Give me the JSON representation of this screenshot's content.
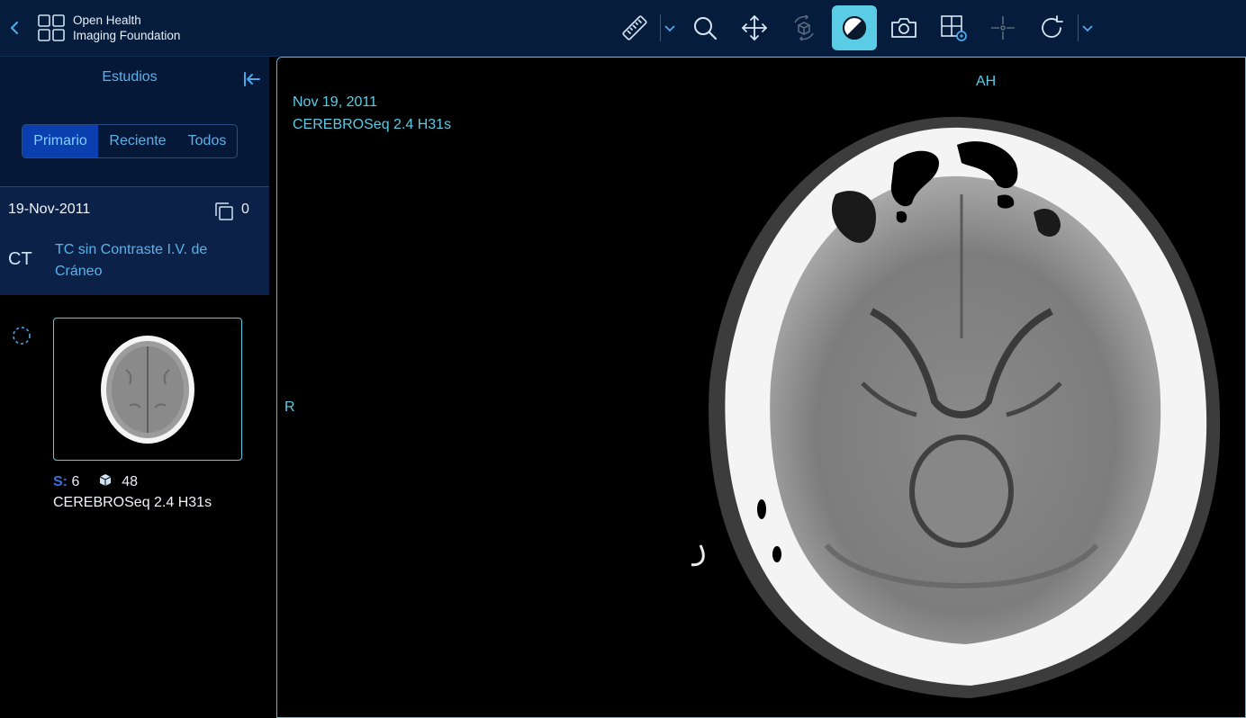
{
  "header": {
    "brand_line1": "Open Health",
    "brand_line2": "Imaging Foundation",
    "back_icon": "chevron-left-icon",
    "logo_icon": "grid-logo-icon"
  },
  "toolbar": {
    "tools": [
      {
        "name": "measure",
        "icon": "ruler-icon",
        "has_dropdown": true
      },
      {
        "name": "zoom",
        "icon": "magnifier-icon"
      },
      {
        "name": "pan",
        "icon": "move-arrows-icon"
      },
      {
        "name": "3d-rotate",
        "icon": "cube-rotate-icon",
        "disabled": true
      },
      {
        "name": "window-level",
        "icon": "contrast-icon",
        "active": true
      },
      {
        "name": "capture",
        "icon": "camera-icon"
      },
      {
        "name": "layout",
        "icon": "layout-gear-icon"
      },
      {
        "name": "crosshairs",
        "icon": "crosshair-icon",
        "disabled": true
      },
      {
        "name": "reset",
        "icon": "rotate-icon",
        "has_dropdown": true
      }
    ]
  },
  "panel": {
    "title": "Estudios",
    "collapse_icon": "collapse-left-icon",
    "tabs": [
      {
        "label": "Primario",
        "selected": true
      },
      {
        "label": "Reciente",
        "selected": false
      },
      {
        "label": "Todos",
        "selected": false
      }
    ],
    "study": {
      "date": "19-Nov-2011",
      "copy_icon": "copy-icon",
      "count": "0",
      "modality": "CT",
      "description": "TC sin Contraste I.V. de Cráneo"
    },
    "series": {
      "s_label": "S:",
      "s_value": "6",
      "instances_icon": "cube-icon",
      "instances": "48",
      "name": "CEREBROSeq 2.4 H31s",
      "loading_icon": "loading-circle-icon"
    }
  },
  "viewport": {
    "date": "Nov 19, 2011",
    "series": "CEREBROSeq 2.4 H31s",
    "orientation_top": "AH",
    "orientation_left": "R"
  },
  "colors": {
    "header_bg": "#051c3d",
    "accent": "#5acce6",
    "link_blue": "#5ab2ea",
    "selected_tab": "#0b3fb0",
    "study_bg": "#0b2148"
  }
}
